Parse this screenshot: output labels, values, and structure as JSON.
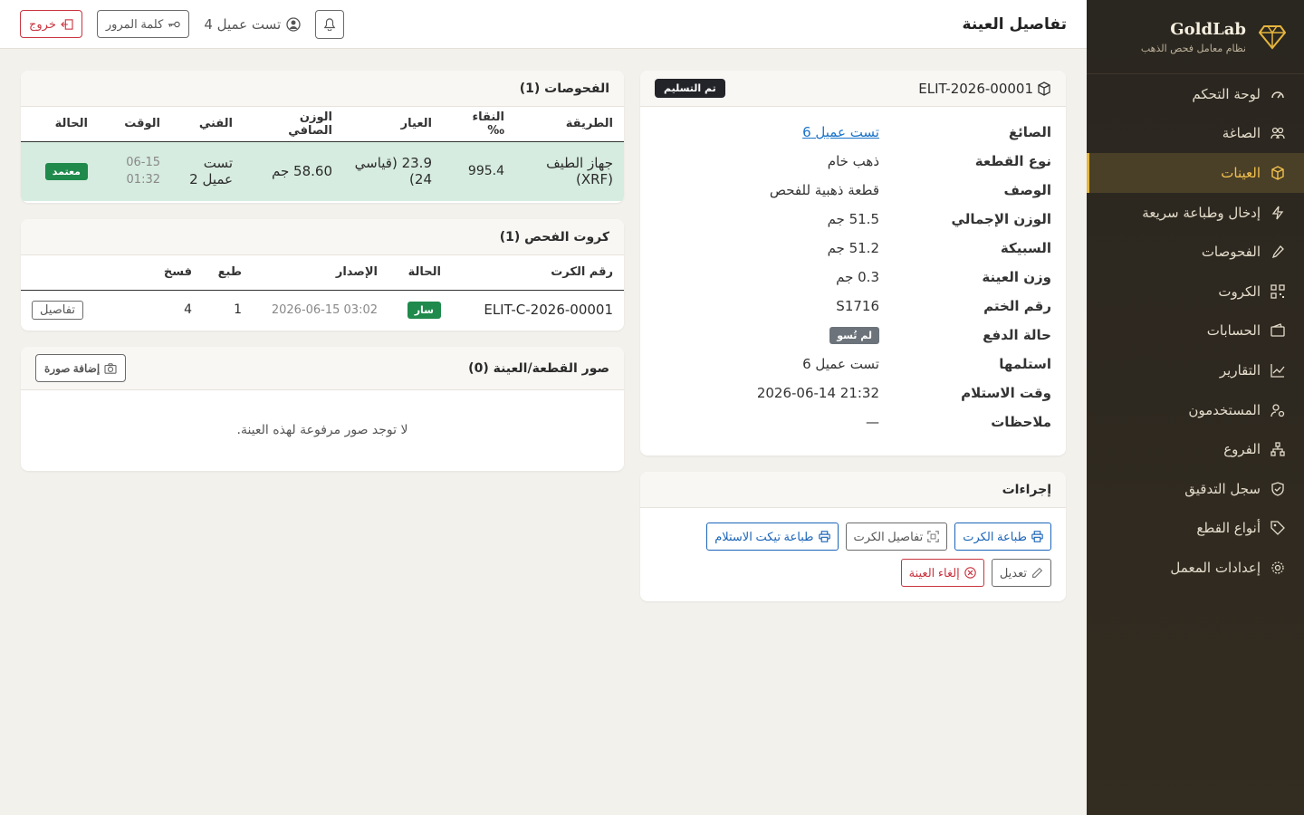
{
  "brand": {
    "name": "GoldLab",
    "subtitle": "نظام معامل فحص الذهب"
  },
  "nav": [
    {
      "label": "لوحة التحكم",
      "icon": "speedometer-icon"
    },
    {
      "label": "الصاغة",
      "icon": "people-icon"
    },
    {
      "label": "العينات",
      "icon": "box-icon",
      "active": true
    },
    {
      "label": "إدخال وطباعة سريعة",
      "icon": "lightning-icon"
    },
    {
      "label": "الفحوصات",
      "icon": "eyedropper-icon"
    },
    {
      "label": "الكروت",
      "icon": "qr-icon"
    },
    {
      "label": "الحسابات",
      "icon": "wallet-icon"
    },
    {
      "label": "التقارير",
      "icon": "chart-line-icon"
    },
    {
      "label": "المستخدمون",
      "icon": "user-gear-icon"
    },
    {
      "label": "الفروع",
      "icon": "sitemap-icon"
    },
    {
      "label": "سجل التدقيق",
      "icon": "shield-check-icon"
    },
    {
      "label": "أنواع القطع",
      "icon": "tag-icon"
    },
    {
      "label": "إعدادات المعمل",
      "icon": "gear-icon"
    }
  ],
  "topbar": {
    "title": "تفاصيل العينة",
    "user": "تست عميل 4",
    "password_label": "كلمة المرور",
    "logout_label": "خروج"
  },
  "sample": {
    "code": "ELIT-2026-00001",
    "status": "تم التسليم",
    "fields": {
      "goldsmith": {
        "label": "الصائغ",
        "value": "تست عميل 6"
      },
      "piece_type": {
        "label": "نوع القطعة",
        "value": "ذهب خام"
      },
      "description": {
        "label": "الوصف",
        "value": "قطعة ذهبية للفحص"
      },
      "gross_weight": {
        "label": "الوزن الإجمالي",
        "value": "51.5 جم"
      },
      "ingot": {
        "label": "السبيكة",
        "value": "51.2 جم"
      },
      "sample_weight": {
        "label": "وزن العينة",
        "value": "0.3 جم"
      },
      "stamp_no": {
        "label": "رقم الختم",
        "value": "S1716"
      },
      "payment_status": {
        "label": "حالة الدفع",
        "value": "لم تُسو"
      },
      "received_by": {
        "label": "استلمها",
        "value": "تست عميل 6"
      },
      "received_at": {
        "label": "وقت الاستلام",
        "value": "2026-06-14 21:32"
      },
      "notes": {
        "label": "ملاحظات",
        "value": "—"
      }
    }
  },
  "actions": {
    "title": "إجراءات",
    "print_card": "طباعة الكرت",
    "card_details": "تفاصيل الكرت",
    "print_receipt": "طباعة تيكت الاستلام",
    "edit": "تعديل",
    "cancel_sample": "إلغاء العينة"
  },
  "exams": {
    "title": "الفحوصات (1)",
    "headers": [
      "الطريقة",
      "النقاء ‰",
      "العيار",
      "الوزن الصافي",
      "الفني",
      "الوقت",
      "الحالة"
    ],
    "rows": [
      {
        "method": "جهاز الطيف (XRF)",
        "purity": "995.4",
        "karat": "23.9 (قياسي 24)",
        "net_weight": "58.60 جم",
        "technician": "تست عميل 2",
        "time_date": "06-15",
        "time_clock": "01:32",
        "status": "معتمد"
      }
    ]
  },
  "cards": {
    "title": "كروت الفحص (1)",
    "headers": [
      "رقم الكرت",
      "الحالة",
      "الإصدار",
      "طبع",
      "فسخ"
    ],
    "rows": [
      {
        "number": "ELIT-C-2026-00001",
        "status": "سار",
        "issued": "2026-06-15 03:02",
        "printed": "1",
        "revoked": "4",
        "details_label": "تفاصيل"
      }
    ]
  },
  "photos": {
    "title": "صور القطعة/العينة (0)",
    "add_label": "إضافة صورة",
    "empty": "لا توجد صور مرفوعة لهذه العينة."
  },
  "colors": {
    "sidebar": "#2a2620",
    "accent": "#e5b53c",
    "success": "#1f8a4c",
    "link": "#1a73c8",
    "danger": "#c9343f"
  }
}
